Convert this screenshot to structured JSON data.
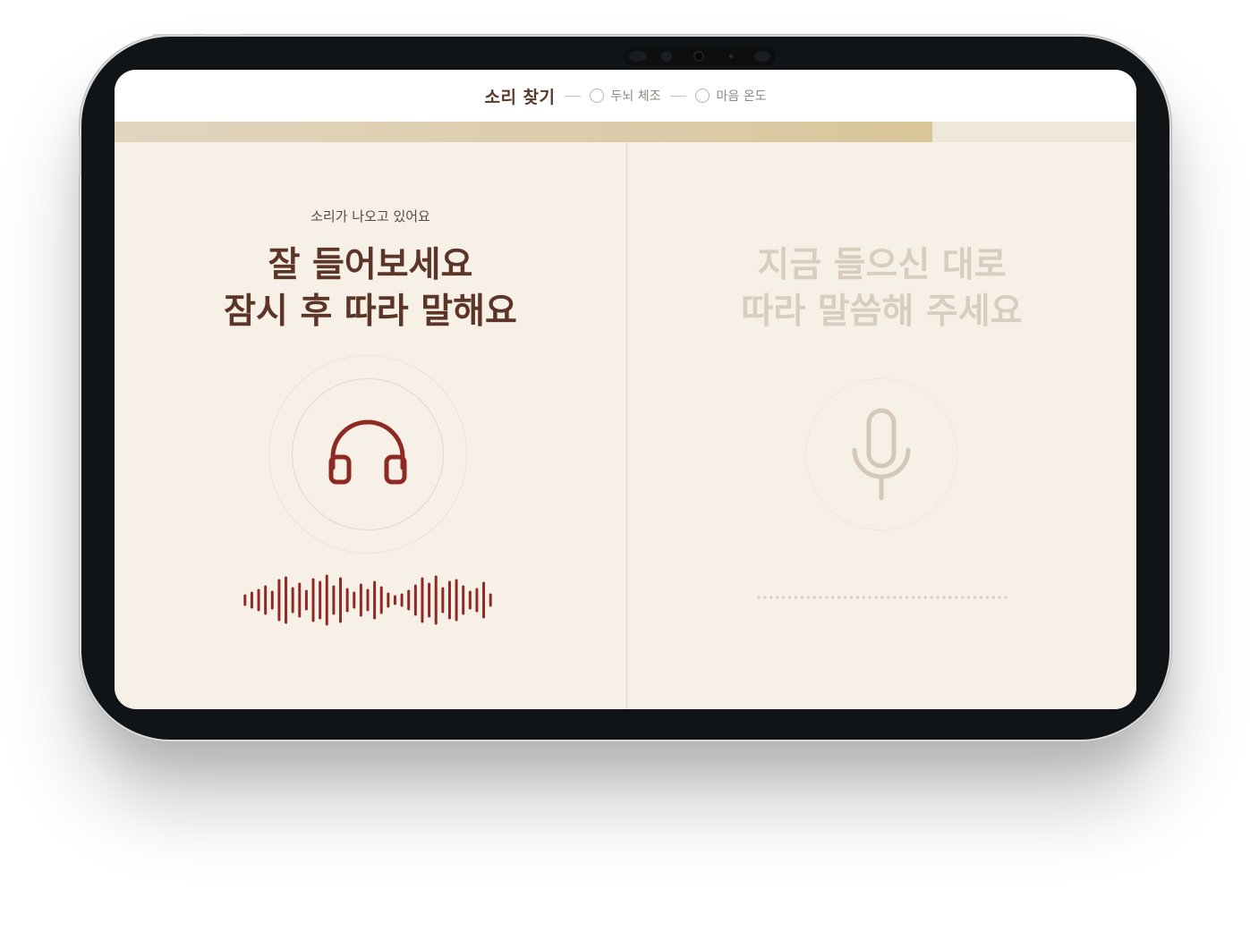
{
  "steps": [
    {
      "label": "소리 찾기",
      "state": "active"
    },
    {
      "label": "두뇌 체조",
      "state": "pending"
    },
    {
      "label": "마음 온도",
      "state": "pending"
    }
  ],
  "progress": {
    "fraction": 0.8
  },
  "listen_panel": {
    "status": "소리가 나오고 있어요",
    "headline_line1": "잘 들어보세요",
    "headline_line2": "잠시 후 따라 말해요",
    "icon": "headphones-icon",
    "accent_color": "#8e2a23"
  },
  "speak_panel": {
    "headline_line1": "지금 들으신 대로",
    "headline_line2": "따라 말씀해 주세요",
    "icon": "microphone-icon",
    "state": "disabled"
  },
  "colors": {
    "background": "#f6f0e6",
    "heading": "#5b3527",
    "accent": "#8e2a23",
    "muted": "#d9cdc0"
  }
}
